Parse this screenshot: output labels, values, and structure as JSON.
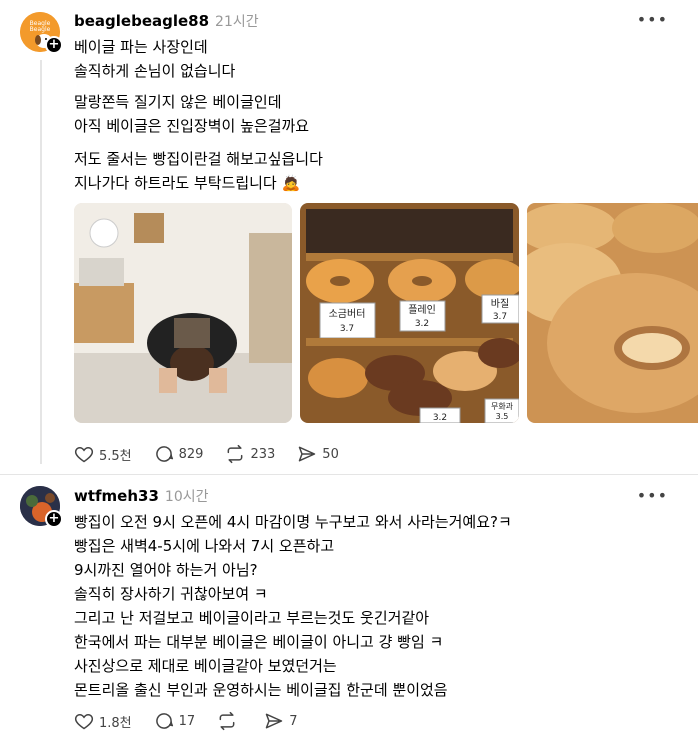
{
  "post1": {
    "username": "beaglebeagle88",
    "time": "21시간",
    "avatar_text": "Beagle Beagle",
    "p1": [
      "베이글 파는 사장인데",
      "솔직하게 손님이 없습니다"
    ],
    "p2": [
      "말랑쫀득 질기지 않은 베이글인데",
      "아직 베이글은 진입장벽이 높은걸까요"
    ],
    "p3": [
      "저도 줄서는 빵집이란걸 해보고싶읍니다",
      "지나가다 하트라도 부탁드립니다 🙇"
    ],
    "price_labels": [
      "소금버터",
      "3.7",
      "플레인",
      "3.2",
      "바질",
      "3.7",
      "3.2",
      "무화과",
      "3.5"
    ],
    "stats": {
      "likes": "5.5천",
      "comments": "829",
      "reposts": "233",
      "shares": "50"
    }
  },
  "post2": {
    "username": "wtfmeh33",
    "time": "10시간",
    "lines": [
      "빵집이 오전 9시 오픈에 4시 마감이명 누구보고 와서 사라는거예요?ㅋ",
      "빵집은 새벽4-5시에 나와서 7시 오픈하고",
      "9시까진 열어야 하는거 아님?",
      "솔직히 장사하기 귀찮아보여 ㅋ",
      "그리고 난 저걸보고 베이글이라고 부르는것도 웃긴거같아",
      "한국에서 파는 대부분 베이글은 베이글이 아니고 걍 빵임 ㅋ",
      "사진상으로 제대로 베이글같아 보였던거는",
      "몬트리올 출신 부인과 운영하시는 베이글집 한군데 뿐이었음"
    ],
    "stats": {
      "likes": "1.8천",
      "comments": "17",
      "reposts": "",
      "shares": "7"
    }
  },
  "more_label": "•••"
}
